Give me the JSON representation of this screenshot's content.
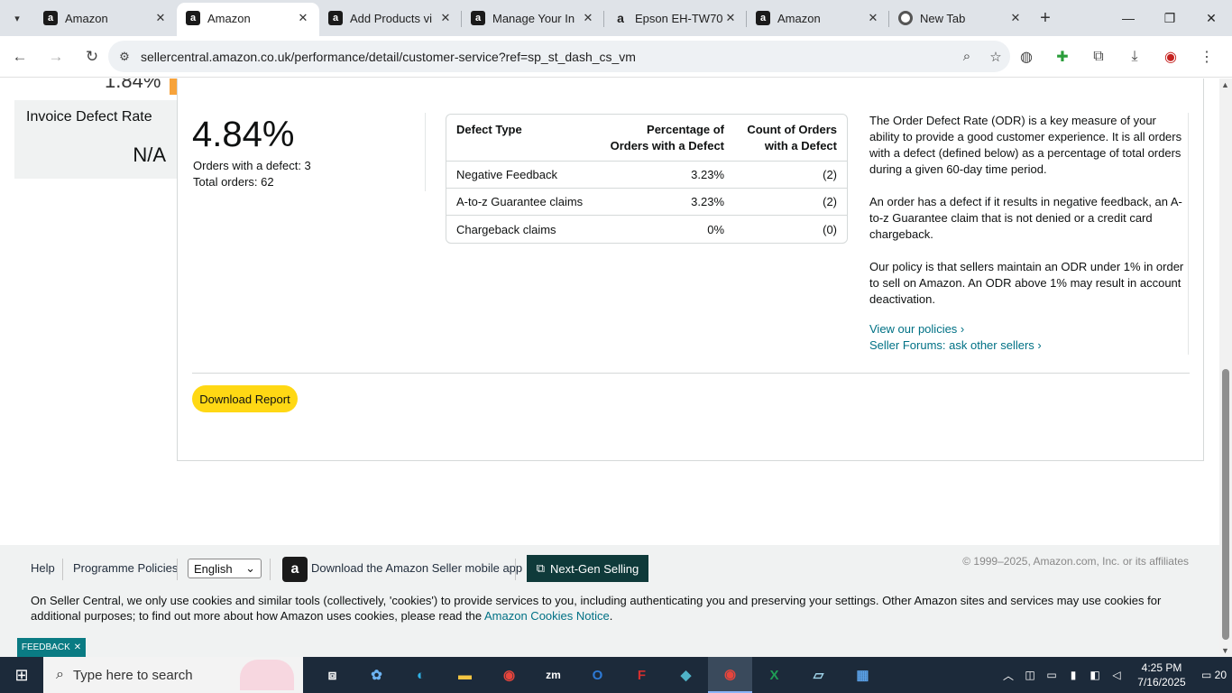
{
  "browser": {
    "tabs": [
      {
        "title": "Amazon",
        "favicon": "amazon-icon",
        "active": false
      },
      {
        "title": "Amazon",
        "favicon": "amazon-icon",
        "active": true
      },
      {
        "title": "Add Products vi",
        "favicon": "amazon-icon",
        "active": false
      },
      {
        "title": "Manage Your In",
        "favicon": "amazon-icon",
        "active": false
      },
      {
        "title": "Epson EH-TW70",
        "favicon": "amazon-smile-icon",
        "active": false
      },
      {
        "title": "Amazon",
        "favicon": "amazon-icon",
        "active": false
      },
      {
        "title": "New Tab",
        "favicon": "chrome-icon",
        "active": false
      }
    ],
    "url": "sellercentral.amazon.co.uk/performance/detail/customer-service?ref=sp_st_dash_cs_vm"
  },
  "sidebar": {
    "top_cut_value": "1.84%",
    "invoice": {
      "title": "Invoice Defect Rate",
      "value": "N/A"
    }
  },
  "odr": {
    "rate": "4.84%",
    "orders_with_defect": "Orders with a defect: 3",
    "total_orders": "Total orders: 62"
  },
  "defect_table": {
    "headers": {
      "type": "Defect Type",
      "pct_line1": "Percentage of",
      "pct_line2": "Orders with a Defect",
      "count_line1": "Count of Orders",
      "count_line2": "with a Defect"
    },
    "rows": [
      {
        "type": "Negative Feedback",
        "pct": "3.23%",
        "count": "(2)"
      },
      {
        "type": "A-to-z Guarantee claims",
        "pct": "3.23%",
        "count": "(2)"
      },
      {
        "type": "Chargeback claims",
        "pct": "0%",
        "count": "(0)"
      }
    ]
  },
  "description": {
    "p1": "The Order Defect Rate (ODR) is a key measure of your ability to provide a good customer experience. It is all orders with a defect (defined below) as a percentage of total orders during a given 60-day time period.",
    "p2": "An order has a defect if it results in negative feedback, an A-to-z Guarantee claim that is not denied or a credit card chargeback.",
    "p3": "Our policy is that sellers maintain an ODR under 1% in order to sell on Amazon. An ODR above 1% may result in account deactivation.",
    "link1": "View our policies ›",
    "link2": "Seller Forums: ask other sellers ›"
  },
  "download_label": "Download Report",
  "footer": {
    "help": "Help",
    "policies": "Programme Policies",
    "language": "English",
    "app": "Download the Amazon Seller mobile app",
    "nextgen": "Next-Gen Selling",
    "copyright": "© 1999–2025, Amazon.com, Inc. or its affiliates",
    "cookie_text": "On Seller Central, we only use cookies and similar tools (collectively, 'cookies') to provide services to you, including authenticating you and preserving your settings. Other Amazon sites and services may use cookies for additional purposes; to find out more about how Amazon uses cookies, please read the ",
    "cookie_link": "Amazon Cookies Notice",
    "cookie_end": "."
  },
  "feedback_label": "FEEDBACK",
  "taskbar": {
    "search_placeholder": "Type here to search",
    "time": "4:25 PM",
    "date": "7/16/2025",
    "notifications": "20"
  },
  "colors": {
    "accent_yellow": "#ffd814",
    "link": "#007185",
    "nextgen": "#0f3a3a",
    "feedback": "#0a7b83"
  }
}
